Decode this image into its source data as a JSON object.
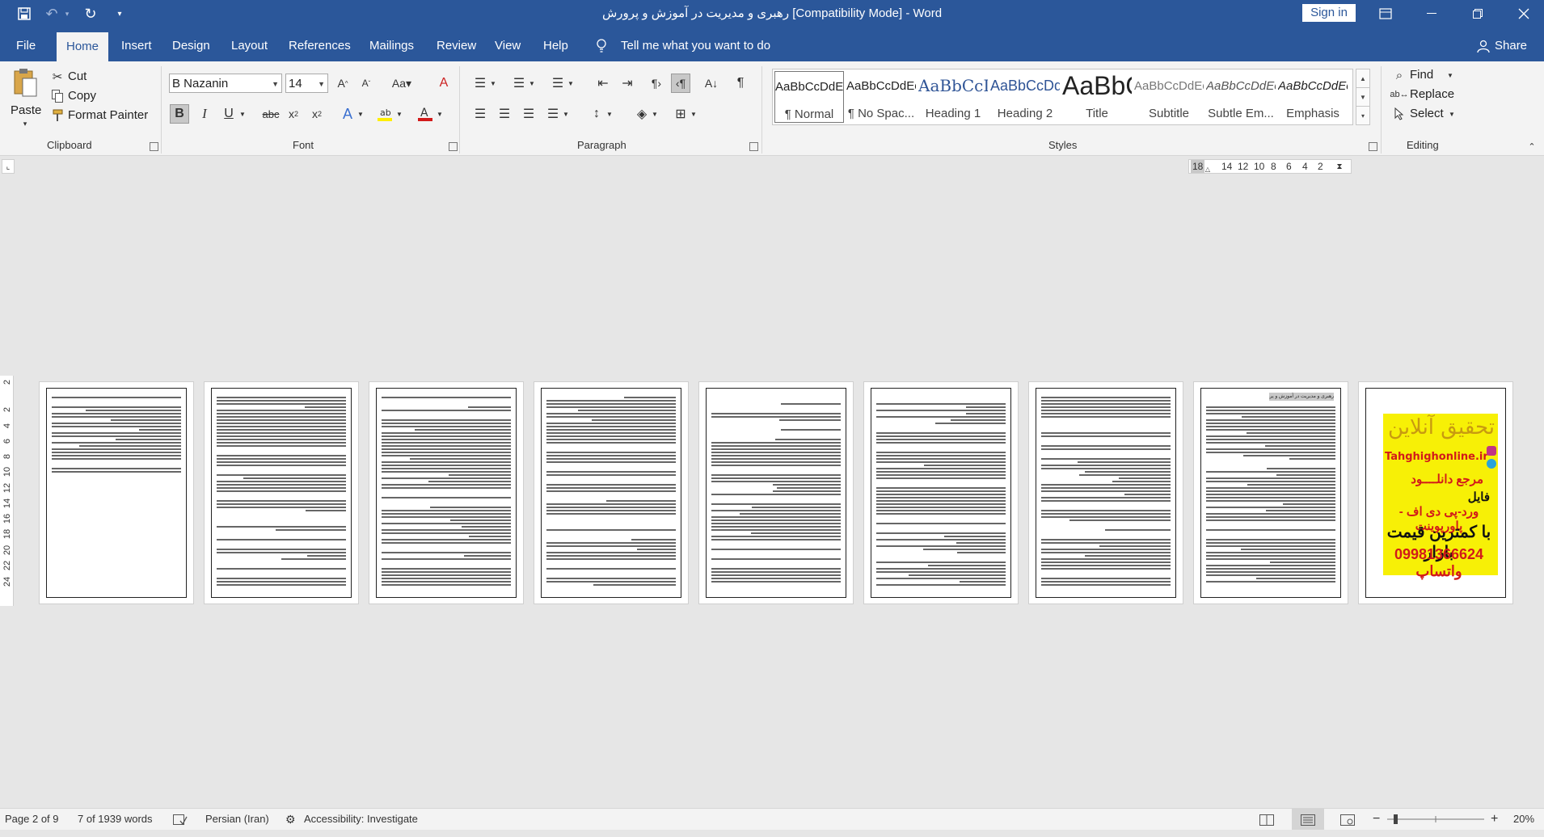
{
  "title_bar": {
    "title": "رهبری و مدیریت  در آموزش و پرورش [Compatibility Mode]  -  Word",
    "signin_label": "Sign in"
  },
  "menu": {
    "file": "File",
    "home": "Home",
    "insert": "Insert",
    "design": "Design",
    "layout": "Layout",
    "references": "References",
    "mailings": "Mailings",
    "review": "Review",
    "view": "View",
    "help": "Help",
    "tell_me": "Tell me what you want to do",
    "share": "Share"
  },
  "clipboard": {
    "paste": "Paste",
    "cut": "Cut",
    "copy": "Copy",
    "format_painter": "Format Painter",
    "group_label": "Clipboard"
  },
  "font": {
    "name": "B Nazanin",
    "size": "14",
    "group_label": "Font"
  },
  "paragraph": {
    "group_label": "Paragraph"
  },
  "styles": {
    "group_label": "Styles",
    "items": [
      {
        "preview": "AaBbCcDdEe",
        "name": "¶ Normal"
      },
      {
        "preview": "AaBbCcDdEe",
        "name": "¶ No Spac..."
      },
      {
        "preview": "AaBbCcDdEe",
        "name": "Heading 1"
      },
      {
        "preview": "AaBbCcDdEe",
        "name": "Heading 2"
      },
      {
        "preview": "AaBbCcDdEe",
        "name": "Title"
      },
      {
        "preview": "AaBbCcDdEe",
        "name": "Subtitle"
      },
      {
        "preview": "AaBbCcDdEe",
        "name": "Subtle Em..."
      },
      {
        "preview": "AaBbCcDdEe",
        "name": "Emphasis"
      }
    ]
  },
  "editing": {
    "find": "Find",
    "replace": "Replace",
    "select": "Select",
    "group_label": "Editing"
  },
  "ruler": {
    "numbers": [
      "18",
      "14",
      "12",
      "10",
      "8",
      "6",
      "4",
      "2"
    ]
  },
  "vertical_ruler": {
    "numbers": [
      "2",
      "2",
      "4",
      "6",
      "8",
      "10",
      "12",
      "14",
      "16",
      "18",
      "20",
      "22",
      "24"
    ]
  },
  "ad_page": {
    "line1": "تحقیق آنلاین",
    "line2": "Tahghighonline.ir",
    "line3": "مرجع دانلــــود",
    "line4": "فایل",
    "line5": "ورد-پی دی اف - پاورپوینت",
    "line6": "با کمترین قیمت بازار",
    "line7": "09981366624 واتساپ"
  },
  "page9": {
    "heading": "رهبری و مدیریت در آموزش و پرورش"
  },
  "status": {
    "page": "Page 2 of 9",
    "words": "7 of 1939 words",
    "language": "Persian (Iran)",
    "accessibility": "Accessibility: Investigate",
    "zoom": "20%"
  },
  "colors": {
    "accent": "#2b579a",
    "ribbon_bg": "#f3f3f3",
    "canvas_bg": "#e6e6e6"
  }
}
